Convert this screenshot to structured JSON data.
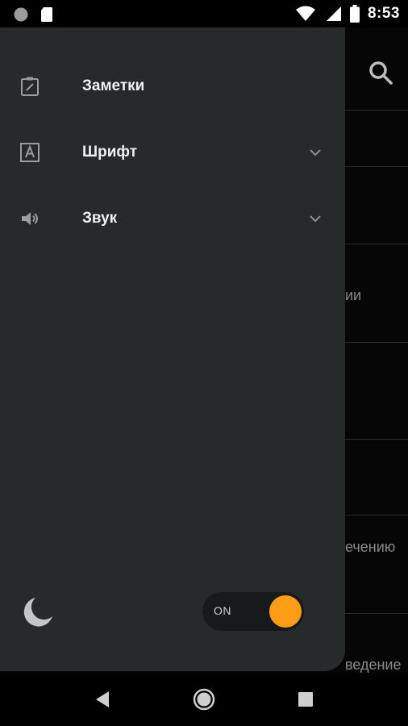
{
  "status_bar": {
    "time": "8:53",
    "icons": [
      "circle-notification-icon",
      "sd-card-icon",
      "wifi-icon",
      "signal-icon",
      "battery-icon"
    ]
  },
  "background_app": {
    "visible_fragments": [
      "ии",
      "ечению",
      "ведение"
    ]
  },
  "drawer": {
    "items": [
      {
        "label": "Заметки",
        "icon": "notes-icon",
        "has_chevron": false
      },
      {
        "label": "Шрифт",
        "icon": "font-icon",
        "has_chevron": true
      },
      {
        "label": "Звук",
        "icon": "volume-icon",
        "has_chevron": true
      }
    ],
    "night_mode": {
      "icon": "moon-icon",
      "toggle_label": "ON",
      "enabled": true
    }
  },
  "colors": {
    "drawer_bg": "#262a2b",
    "accent": "#ff9c16",
    "text": "#f0f0f0",
    "icon": "#9a9d9e"
  },
  "nav_bar": {
    "buttons": [
      "back-icon",
      "home-icon",
      "recents-icon"
    ]
  }
}
